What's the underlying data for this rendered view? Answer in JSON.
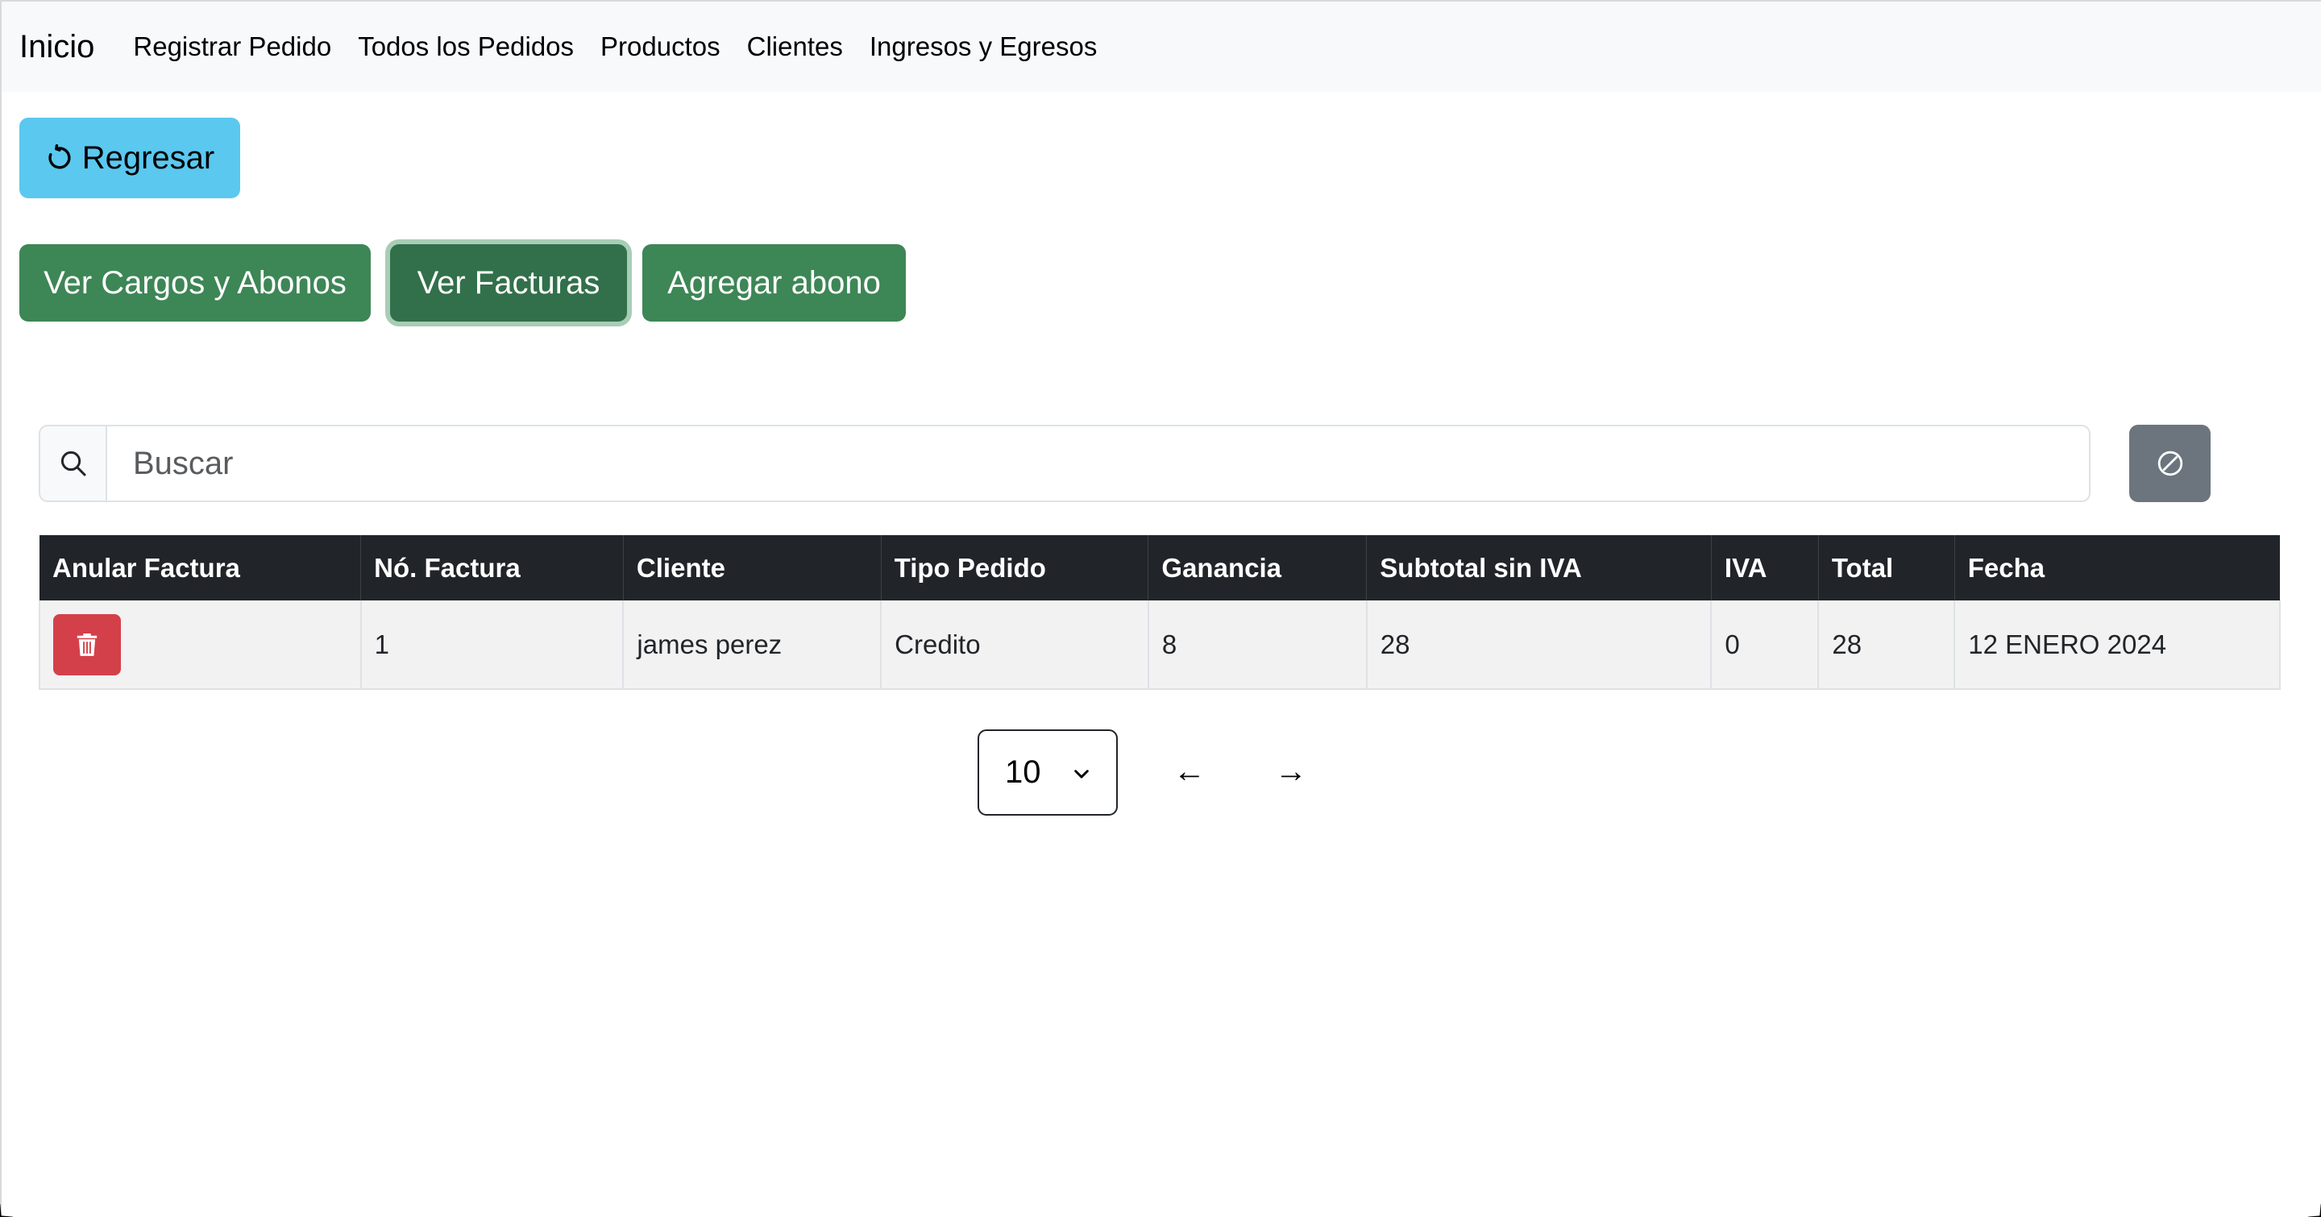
{
  "navbar": {
    "brand": "Inicio",
    "items": [
      {
        "label": "Registrar Pedido"
      },
      {
        "label": "Todos los Pedidos"
      },
      {
        "label": "Productos"
      },
      {
        "label": "Clientes"
      },
      {
        "label": "Ingresos y Egresos"
      }
    ]
  },
  "actions": {
    "back_label": "Regresar",
    "cargos_label": "Ver Cargos y Abonos",
    "facturas_label": "Ver Facturas",
    "abono_label": "Agregar abono"
  },
  "search": {
    "placeholder": "Buscar",
    "value": ""
  },
  "table": {
    "headers": [
      "Anular Factura",
      "Nó. Factura",
      "Cliente",
      "Tipo Pedido",
      "Ganancia",
      "Subtotal sin IVA",
      "IVA",
      "Total",
      "Fecha"
    ],
    "rows": [
      {
        "numero": "1",
        "cliente": "james perez",
        "tipo": "Credito",
        "ganancia": "8",
        "subtotal": "28",
        "iva": "0",
        "total": "28",
        "fecha": "12 ENERO 2024"
      }
    ]
  },
  "pagination": {
    "page_size": "10",
    "prev": "←",
    "next": "→"
  },
  "colors": {
    "navbar_bg": "#f8f9fa",
    "info": "#5bc8ef",
    "success": "#3d8656",
    "danger": "#d4404a",
    "secondary": "#6c757d",
    "table_header": "#212529"
  },
  "icons": {
    "back": "arrow-counterclockwise-icon",
    "search": "search-icon",
    "clear": "slash-circle-icon",
    "delete": "trash-icon",
    "select": "chevron-down-icon"
  }
}
